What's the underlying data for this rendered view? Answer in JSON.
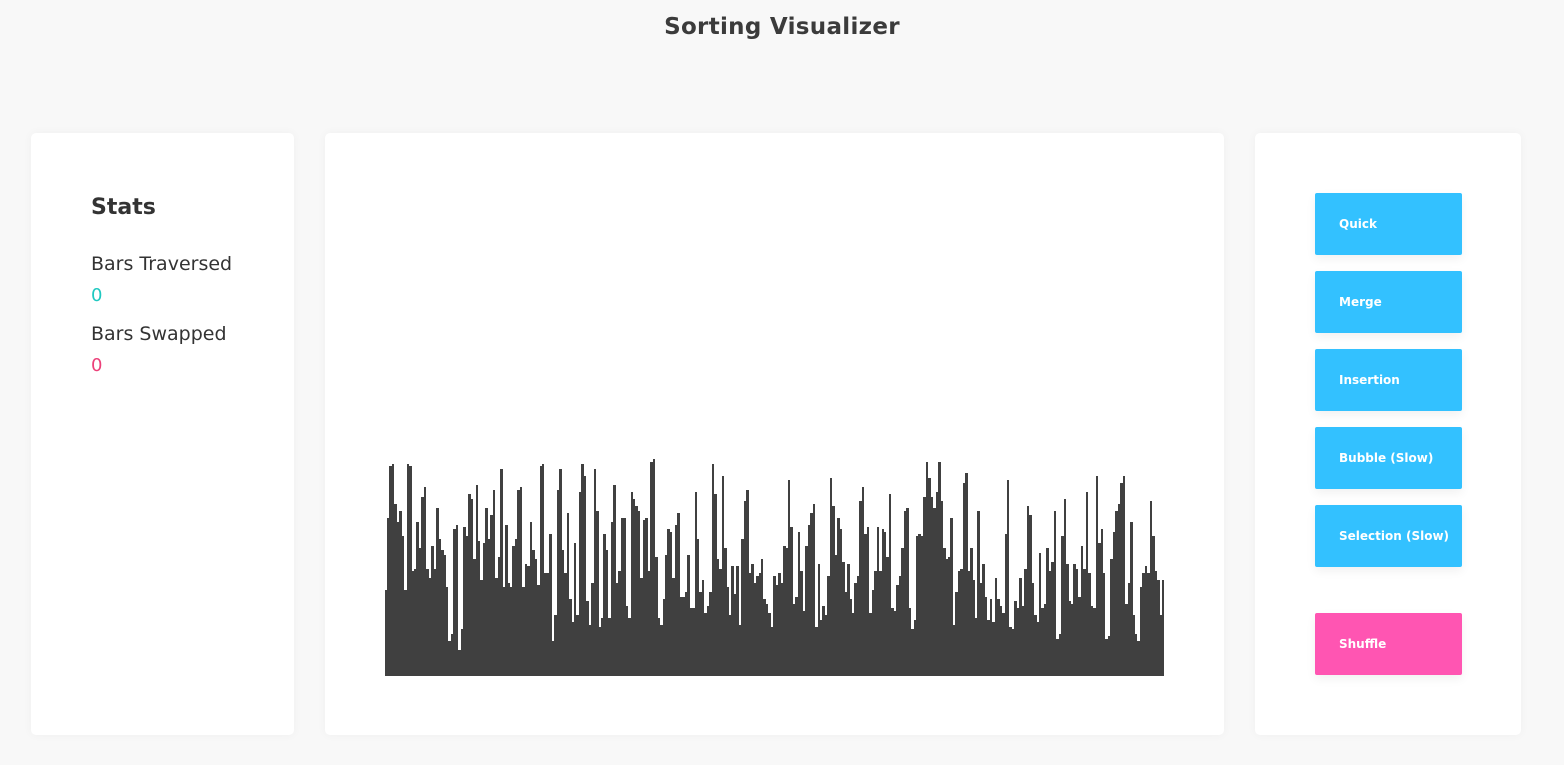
{
  "header": {
    "title": "Sorting Visualizer"
  },
  "stats": {
    "heading": "Stats",
    "traversed_label": "Bars Traversed",
    "traversed_value": "0",
    "swapped_label": "Bars Swapped",
    "swapped_value": "0"
  },
  "visualizer": {
    "bar_color": "#404040",
    "max_value": 100,
    "bars": [
      37,
      68,
      90,
      91,
      74,
      66,
      71,
      60,
      37,
      91,
      90,
      45,
      46,
      66,
      55,
      77,
      81,
      46,
      42,
      56,
      46,
      72,
      59,
      54,
      52,
      38,
      15,
      18,
      63,
      65,
      11,
      20,
      64,
      60,
      78,
      76,
      50,
      82,
      58,
      41,
      57,
      72,
      59,
      69,
      80,
      42,
      51,
      89,
      38,
      65,
      40,
      38,
      56,
      59,
      80,
      81,
      38,
      48,
      47,
      66,
      54,
      50,
      39,
      90,
      91,
      44,
      44,
      61,
      15,
      26,
      80,
      89,
      54,
      44,
      70,
      33,
      23,
      57,
      26,
      79,
      91,
      86,
      32,
      22,
      40,
      89,
      71,
      21,
      25,
      61,
      54,
      25,
      66,
      82,
      40,
      45,
      68,
      68,
      30,
      25,
      79,
      76,
      73,
      71,
      42,
      67,
      68,
      45,
      92,
      93,
      51,
      25,
      22,
      33,
      52,
      63,
      62,
      42,
      65,
      70,
      34,
      34,
      36,
      52,
      29,
      29,
      79,
      59,
      36,
      41,
      27,
      30,
      36,
      91,
      78,
      50,
      46,
      86,
      55,
      38,
      26,
      47,
      35,
      47,
      22,
      59,
      75,
      80,
      44,
      48,
      40,
      43,
      44,
      50,
      33,
      31,
      27,
      21,
      43,
      39,
      44,
      40,
      56,
      55,
      84,
      64,
      31,
      34,
      62,
      45,
      28,
      56,
      65,
      70,
      74,
      21,
      48,
      24,
      30,
      26,
      43,
      85,
      73,
      52,
      68,
      63,
      49,
      36,
      48,
      33,
      27,
      40,
      43,
      75,
      81,
      61,
      64,
      27,
      37,
      45,
      64,
      45,
      63,
      62,
      51,
      78,
      29,
      28,
      39,
      43,
      55,
      71,
      72,
      29,
      20,
      24,
      60,
      61,
      60,
      77,
      92,
      85,
      77,
      72,
      79,
      92,
      75,
      55,
      50,
      51,
      68,
      22,
      36,
      45,
      46,
      83,
      87,
      45,
      55,
      41,
      25,
      71,
      40,
      48,
      34,
      24,
      33,
      23,
      42,
      33,
      30,
      27,
      61,
      84,
      21,
      20,
      32,
      29,
      42,
      30,
      46,
      73,
      69,
      40,
      26,
      23,
      53,
      29,
      31,
      55,
      45,
      49,
      71,
      16,
      18,
      60,
      76,
      48,
      32,
      31,
      48,
      46,
      34,
      56,
      46,
      79,
      44,
      30,
      29,
      86,
      57,
      63,
      44,
      16,
      17,
      50,
      62,
      71,
      74,
      83,
      86,
      31,
      40,
      66,
      26,
      18,
      15,
      38,
      44,
      47,
      44,
      75,
      60,
      45,
      41,
      26,
      41
    ]
  },
  "controls": {
    "quick": "Quick",
    "merge": "Merge",
    "insertion": "Insertion",
    "bubble": "Bubble (Slow)",
    "selection": "Selection (Slow)",
    "shuffle": "Shuffle"
  },
  "colors": {
    "background": "#f8f8f8",
    "card": "#ffffff",
    "algo_button": "#33c1ff",
    "shuffle_button": "#ff55b2",
    "traversed_value": "#1fc8c0",
    "swapped_value": "#ec4079",
    "bar": "#404040"
  }
}
